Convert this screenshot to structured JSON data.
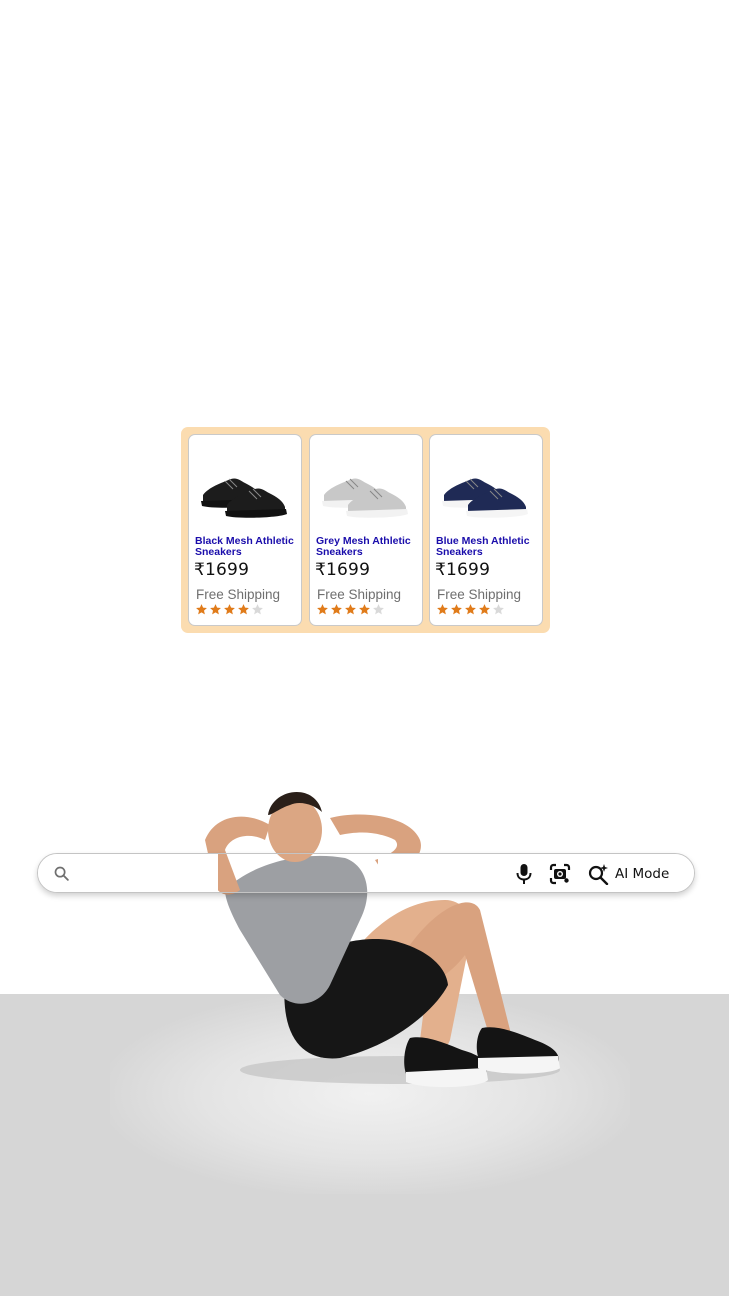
{
  "carousel": {
    "products": [
      {
        "title": "Black Mesh Athletic Sneakers",
        "price": "₹1699",
        "shipping": "Free Shipping",
        "rating": 4,
        "rating_max": 5,
        "shoe_color": "#1c1c1c",
        "sole_color": "#111111"
      },
      {
        "title": "Grey Mesh Athletic Sneakers",
        "price": "₹1699",
        "shipping": "Free Shipping",
        "rating": 4,
        "rating_max": 5,
        "shoe_color": "#c8c8c8",
        "sole_color": "#f2f2f2"
      },
      {
        "title": "Blue Mesh Athletic Sneakers",
        "price": "₹1699",
        "shipping": "Free Shipping",
        "rating": 4,
        "rating_max": 5,
        "shoe_color": "#1f2a55",
        "sole_color": "#f5f5f5"
      }
    ],
    "colors": {
      "background": "#fbdcb0",
      "title": "#1a0dab",
      "star_filled": "#e07b1a",
      "star_empty": "#d9d9d9"
    }
  },
  "searchbar": {
    "query": "",
    "placeholder": "",
    "ai_mode_label": "AI Mode",
    "icons": [
      "search-icon",
      "mic-icon",
      "lens-icon",
      "ai-mode-icon"
    ]
  },
  "scene": {
    "person": "man doing sit-up in grey t-shirt, black shorts and black sneakers",
    "floor_color": "#d6d6d6"
  }
}
